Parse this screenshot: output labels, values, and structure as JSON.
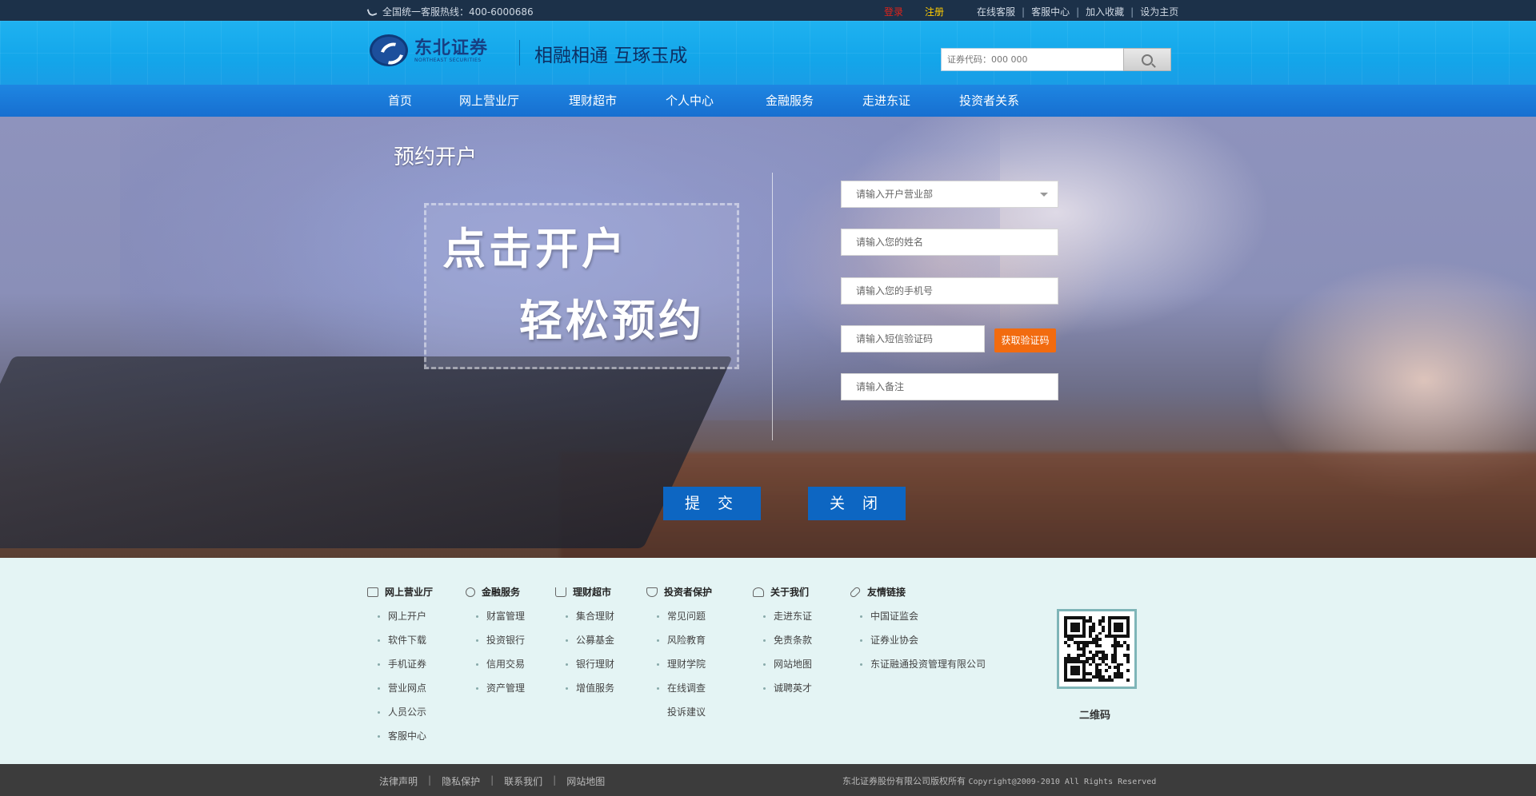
{
  "topbar": {
    "hotline": "全国统一客服热线：400-6000686",
    "login": "登录",
    "register": "注册",
    "links": [
      "在线客服",
      "客服中心",
      "加入收藏",
      "设为主页"
    ]
  },
  "header": {
    "logo_cn": "东北证券",
    "logo_en": "NORTHEAST SECURITIES",
    "slogan": "相融相通 互琢玉成",
    "search_placeholder": "证券代码：000 000"
  },
  "nav": [
    "首页",
    "网上营业厅",
    "理财超市",
    "个人中心",
    "金融服务",
    "走进东证",
    "投资者关系"
  ],
  "hero": {
    "heading": "预约开户",
    "promo_line1": "点击开户",
    "promo_line2": "轻松预约"
  },
  "form": {
    "branch_placeholder": "请输入开户营业部",
    "name_placeholder": "请输入您的姓名",
    "phone_placeholder": "请输入您的手机号",
    "sms_placeholder": "请输入短信验证码",
    "get_code": "获取验证码",
    "note_placeholder": "请输入备注",
    "submit": "提 交",
    "close": "关 闭"
  },
  "footer": {
    "columns": [
      {
        "icon": "monitor-icon",
        "title": "网上营业厅",
        "items": [
          "网上开户",
          "软件下载",
          "手机证券",
          "营业网点",
          "人员公示",
          "客服中心"
        ]
      },
      {
        "icon": "people-icon",
        "title": "金融服务",
        "items": [
          "财富管理",
          "投资银行",
          "信用交易",
          "资产管理"
        ]
      },
      {
        "icon": "cart-icon",
        "title": "理财超市",
        "items": [
          "集合理财",
          "公募基金",
          "银行理财",
          "增值服务"
        ]
      },
      {
        "icon": "shield-icon",
        "title": "投资者保护",
        "items": [
          "常见问题",
          "风险教育",
          "理财学院",
          "在线调查",
          "投诉建议"
        ]
      },
      {
        "icon": "person-icon",
        "title": "关于我们",
        "items": [
          "走进东证",
          "免责条款",
          "网站地图",
          "诚聘英才"
        ]
      },
      {
        "icon": "link-icon",
        "title": "友情链接",
        "items": [
          "中国证监会",
          "证券业协会",
          "东证融通投资管理有限公司"
        ]
      }
    ],
    "qr_label": "二维码"
  },
  "bottom": {
    "links": [
      "法律声明",
      "隐私保护",
      "联系我们",
      "网站地图"
    ],
    "copyright_cn": "东北证券股份有限公司版权所有",
    "copyright_en": "Copyright@2009-2010 All Rights Reserved"
  },
  "colors": {
    "header_blue": "#13a6ea",
    "nav_blue": "#1a78d8",
    "button_blue": "#0d66c2",
    "code_orange": "#f26b0f",
    "login_red": "#e2231a",
    "register_yellow": "#ffcc00"
  }
}
